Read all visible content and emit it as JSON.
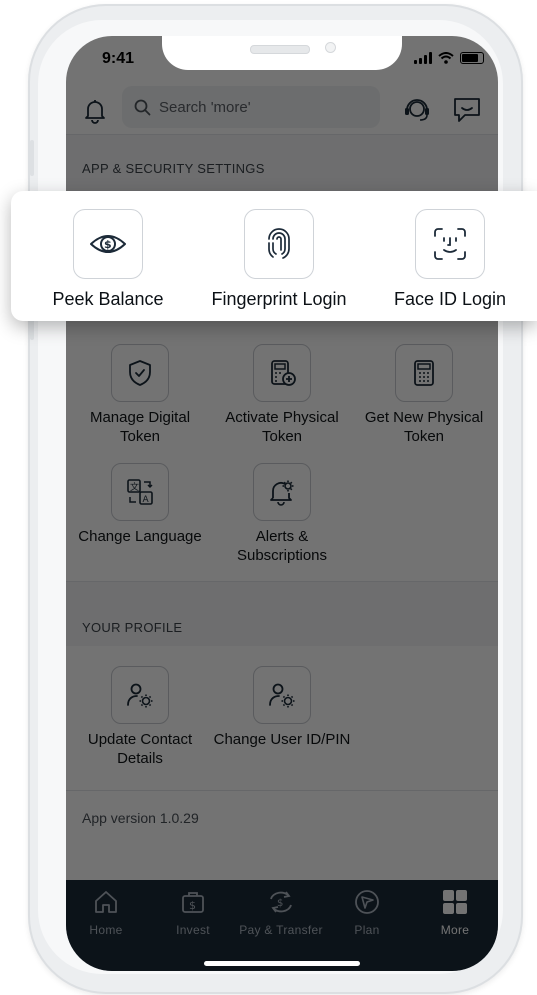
{
  "status_bar": {
    "time": "9:41"
  },
  "header": {
    "search_placeholder": "Search 'more'",
    "icons": [
      "bell-icon",
      "search-icon",
      "support-agent-icon",
      "chat-icon"
    ]
  },
  "sections": {
    "app_security_label": "APP & SECURITY SETTINGS",
    "your_profile_label": "YOUR PROFILE"
  },
  "highlight_tiles": [
    {
      "label": "Peek Balance",
      "icon": "eye-dollar-icon"
    },
    {
      "label": "Fingerprint Login",
      "icon": "fingerprint-icon"
    },
    {
      "label": "Face ID Login",
      "icon": "face-id-icon"
    }
  ],
  "security_tiles": [
    {
      "label": "Manage Digital Token",
      "icon": "shield-check-icon"
    },
    {
      "label": "Activate Physical Token",
      "icon": "token-add-icon"
    },
    {
      "label": "Get New Physical Token",
      "icon": "calculator-token-icon"
    },
    {
      "label": "Change Language",
      "icon": "language-icon"
    },
    {
      "label": "Alerts & Subscriptions",
      "icon": "bell-gear-icon"
    }
  ],
  "profile_tiles": [
    {
      "label": "Update Contact Details",
      "icon": "user-gear-icon"
    },
    {
      "label": "Change User ID/PIN",
      "icon": "user-gear-icon"
    }
  ],
  "app_version": "App version 1.0.29",
  "tabbar": [
    {
      "label": "Home",
      "icon": "home-icon",
      "active": false
    },
    {
      "label": "Invest",
      "icon": "invest-bag-icon",
      "active": false
    },
    {
      "label": "Pay & Transfer",
      "icon": "pay-transfer-icon",
      "active": false
    },
    {
      "label": "Plan",
      "icon": "compass-icon",
      "active": false
    },
    {
      "label": "More",
      "icon": "grid-icon",
      "active": true
    }
  ],
  "colors": {
    "tabbar_bg": "#1b2a39",
    "overlay": "rgba(0,0,0,0.55)",
    "icon_stroke": "#1c2a38"
  }
}
